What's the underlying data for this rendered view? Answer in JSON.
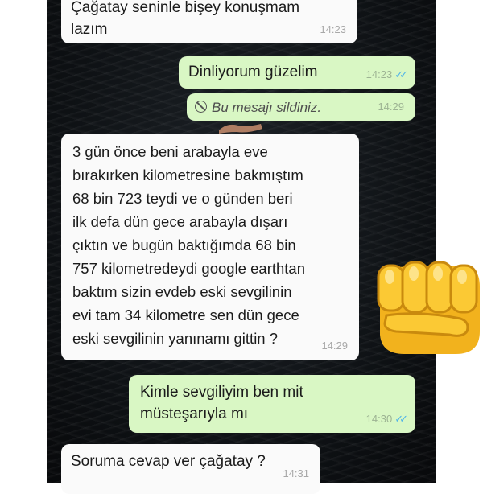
{
  "messages": [
    {
      "text": "Çağatay seninle bişey konuşmam\nlazım",
      "time": "14:23"
    },
    {
      "text": "Dinliyorum güzelim",
      "time": "14:23",
      "ticks": "✓✓"
    },
    {
      "text": "Bu mesajı sildiniz.",
      "time": "14:29"
    },
    {
      "text": "3 gün önce beni arabayla eve\nbırakırken kilometresine bakmıştım\n68 bin 723 teydi ve o günden beri\nilk defa dün gece arabayla dışarı\nçıktın ve bugün baktığımda 68 bin\n757 kilometredeydi google earthtan\nbaktım sizin evdeb eski sevgilinin\nevi tam 34 kilometre sen dün gece\neski sevgilinin yanınamı gittin ?",
      "time": "14:29"
    },
    {
      "text": "Kimle sevgiliyim ben mit\nmüsteşarıyla mı",
      "time": "14:30",
      "ticks": "✓✓"
    },
    {
      "text": "Soruma cevap ver çağatay ?",
      "time": "14:31"
    }
  ],
  "colors": {
    "incoming": "#fafafa",
    "outgoing": "#d9f7c4",
    "ticks": "#4fb3e8"
  },
  "sticker": {
    "icon": "oncoming-fist-emoji"
  }
}
